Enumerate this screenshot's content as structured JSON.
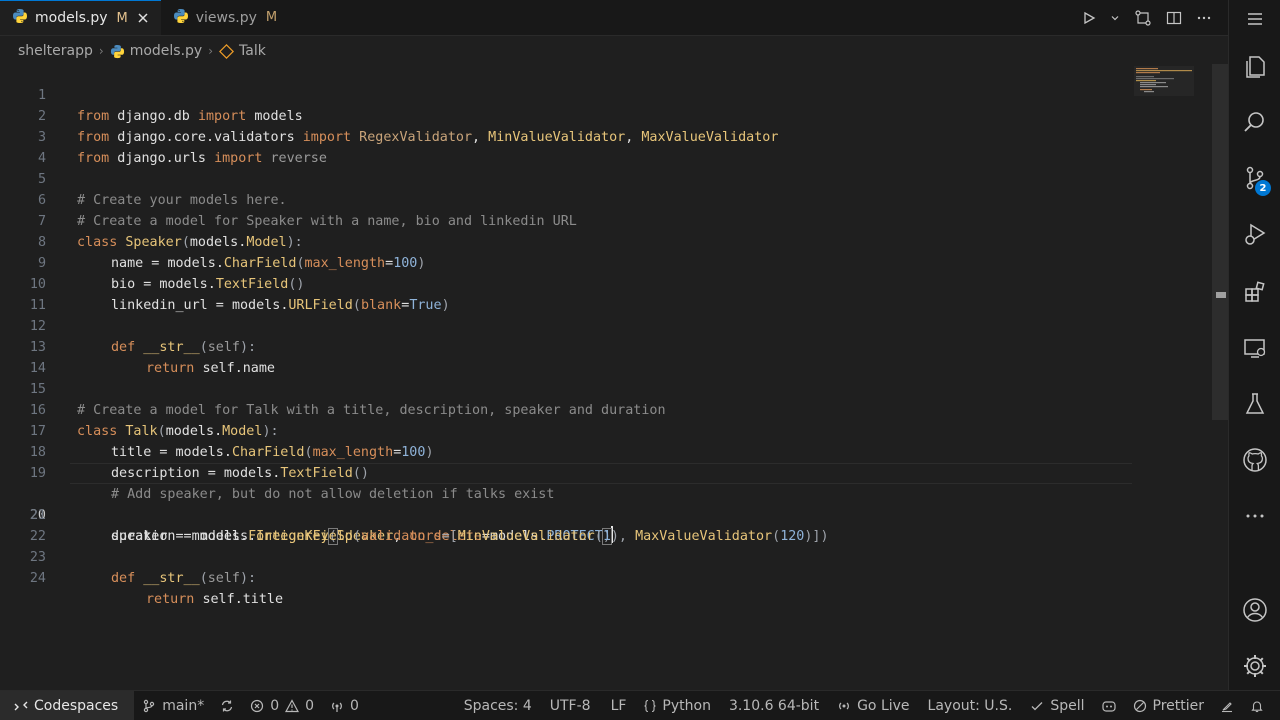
{
  "tabs": [
    {
      "name": "models.py",
      "status": "M",
      "active": true
    },
    {
      "name": "views.py",
      "status": "M",
      "active": false
    }
  ],
  "breadcrumb": {
    "folder": "shelterapp",
    "file": "models.py",
    "symbol": "Talk"
  },
  "editor": {
    "current_line": 20,
    "lines": [
      {
        "n": "1"
      },
      {
        "n": "2"
      },
      {
        "n": "3"
      },
      {
        "n": "4"
      },
      {
        "n": "5"
      },
      {
        "n": "6"
      },
      {
        "n": "7"
      },
      {
        "n": "8"
      },
      {
        "n": "9"
      },
      {
        "n": "10"
      },
      {
        "n": "11"
      },
      {
        "n": "12"
      },
      {
        "n": "13"
      },
      {
        "n": "14"
      },
      {
        "n": "15"
      },
      {
        "n": "16"
      },
      {
        "n": "17"
      },
      {
        "n": "18"
      },
      {
        "n": "19"
      },
      {
        "n": "20"
      },
      {
        "n": "21"
      },
      {
        "n": "22"
      },
      {
        "n": "23"
      },
      {
        "n": "24"
      }
    ],
    "tokens": {
      "l1": [
        "from",
        " django.db ",
        "import",
        " models"
      ],
      "l2": [
        "from",
        " django.core.validators ",
        "import",
        " RegexValidator",
        ", ",
        "MinValueValidator",
        ", ",
        "MaxValueValidator"
      ],
      "l3": [
        "from",
        " django.urls ",
        "import",
        " reverse"
      ],
      "l5": "# Create your models here.",
      "l6": "# Create a model for Speaker with a name, bio and linkedin URL",
      "l7": [
        "class",
        " ",
        "Speaker",
        "(",
        "models",
        ".",
        "Model",
        "):"
      ],
      "l8": [
        "name",
        " = ",
        "models",
        ".",
        "CharField",
        "(",
        "max_length",
        "=",
        "100",
        ")"
      ],
      "l9": [
        "bio",
        " = ",
        "models",
        ".",
        "TextField",
        "()"
      ],
      "l10": [
        "linkedin_url",
        " = ",
        "models",
        ".",
        "URLField",
        "(",
        "blank",
        "=",
        "True",
        ")"
      ],
      "l12": [
        "def",
        " ",
        "__str__",
        "(",
        "self",
        "):"
      ],
      "l13": [
        "return",
        " ",
        "self",
        ".",
        "name"
      ],
      "l15": "# Create a model for Talk with a title, description, speaker and duration",
      "l16": [
        "class",
        " ",
        "Talk",
        "(",
        "models",
        ".",
        "Model",
        "):"
      ],
      "l17": [
        "title",
        " = ",
        "models",
        ".",
        "CharField",
        "(",
        "max_length",
        "=",
        "100",
        ")"
      ],
      "l18": [
        "description",
        " = ",
        "models",
        ".",
        "TextField",
        "()"
      ],
      "l19": "# Add speaker, but do not allow deletion if talks exist",
      "l20": [
        "speaker",
        " = ",
        "models",
        ".",
        "ForeignKey",
        "(",
        "Speaker",
        ", ",
        "on_delete",
        "=",
        "models",
        ".",
        "PROTECT",
        ")"
      ],
      "l21": [
        "duration",
        " = ",
        "models",
        ".",
        "IntegerField",
        "(",
        "validators",
        "=[",
        "MinValueValidator",
        "(",
        "1",
        "), ",
        "MaxValueValidator",
        "(",
        "120",
        ")])"
      ],
      "l23": [
        "def",
        " ",
        "__str__",
        "(",
        "self",
        "):"
      ],
      "l24": [
        "return",
        " ",
        "self",
        ".",
        "title"
      ]
    }
  },
  "activitybar": {
    "source_control_badge": "2"
  },
  "statusbar": {
    "remote": "Codespaces",
    "branch": "main*",
    "errors": "0",
    "warnings": "0",
    "ports": "0",
    "spaces": "Spaces: 4",
    "encoding": "UTF-8",
    "eol": "LF",
    "language": "Python",
    "interpreter": "3.10.6 64-bit",
    "golive": "Go Live",
    "layout": "Layout: U.S.",
    "spell": "Spell",
    "prettier": "Prettier"
  },
  "colors": {
    "accent": "#0078d4",
    "keyword": "#d68e5a",
    "type": "#e7c57a",
    "number": "#8fb3d9",
    "comment": "#8b8b8b"
  }
}
